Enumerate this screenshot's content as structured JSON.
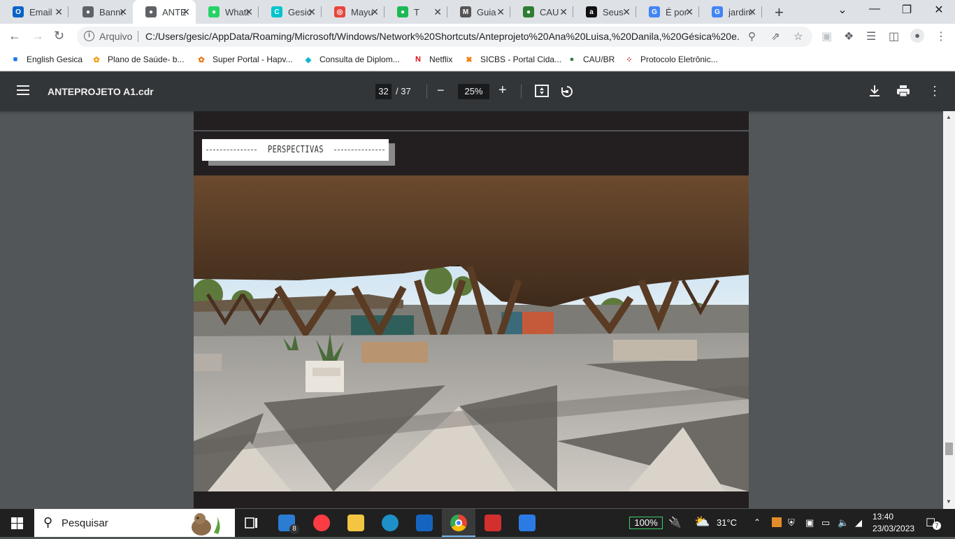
{
  "browser": {
    "tabs": [
      {
        "title": "Email",
        "icon": "outlook-icon",
        "color": "#0a64c8",
        "glyph": "O"
      },
      {
        "title": "Banner",
        "icon": "globe-icon",
        "color": "#5f6368",
        "glyph": "●"
      },
      {
        "title": "ANTEPROJETO",
        "icon": "globe-icon",
        "color": "#5f6368",
        "glyph": "●"
      },
      {
        "title": "WhatsApp",
        "icon": "whatsapp-icon",
        "color": "#25d366",
        "glyph": "●"
      },
      {
        "title": "Gesica",
        "icon": "canva-icon",
        "color": "#00c4cc",
        "glyph": "C"
      },
      {
        "title": "Mayu",
        "icon": "target-icon",
        "color": "#e8453c",
        "glyph": "◎"
      },
      {
        "title": "T",
        "icon": "spotify-icon",
        "color": "#1db954",
        "glyph": "●"
      },
      {
        "title": "Guia",
        "icon": "medium-icon",
        "color": "#555555",
        "glyph": "M"
      },
      {
        "title": "CAU",
        "icon": "cau-icon",
        "color": "#2e7d32",
        "glyph": "●"
      },
      {
        "title": "Seus",
        "icon": "amazon-icon",
        "color": "#111111",
        "glyph": "a"
      },
      {
        "title": "É por",
        "icon": "google-icon",
        "color": "#4285f4",
        "glyph": "G"
      },
      {
        "title": "jardim",
        "icon": "google-icon",
        "color": "#4285f4",
        "glyph": "G"
      }
    ],
    "new_tab": "+",
    "window_controls": {
      "list": "⌄",
      "minimize": "—",
      "restore": "❐",
      "close": "✕"
    },
    "address": {
      "scheme_label": "Arquivo",
      "url": "C:/Users/gesic/AppData/Roaming/Microsoft/Windows/Network%20Shortcuts/Anteprojeto%20Ana%20Luisa,%20Danila,%20Gésica%20e..."
    },
    "bookmarks": [
      {
        "label": "English Gesica",
        "icon": "contact-icon",
        "color": "#1a73e8",
        "glyph": "■"
      },
      {
        "label": "Plano de Saúde- b...",
        "icon": "flower-icon",
        "color": "#f29900",
        "glyph": "✿"
      },
      {
        "label": "Super Portal - Hapv...",
        "icon": "flower-icon",
        "color": "#e8710a",
        "glyph": "✿"
      },
      {
        "label": "Consulta de Diplom...",
        "icon": "diamond-icon",
        "color": "#12b5cb",
        "glyph": "◆"
      },
      {
        "label": "Netflix",
        "icon": "netflix-icon",
        "color": "#e50914",
        "glyph": "N"
      },
      {
        "label": "SICBS - Portal Cida...",
        "icon": "sicbs-icon",
        "color": "#f57c00",
        "glyph": "✖"
      },
      {
        "label": "CAU/BR",
        "icon": "cau-icon",
        "color": "#2e7d32",
        "glyph": "●"
      },
      {
        "label": "Protocolo Eletrônic...",
        "icon": "dots-icon",
        "color": "#c5221f",
        "glyph": "⁘"
      }
    ]
  },
  "pdf": {
    "title": "ANTEPROJETO A1.cdr",
    "current_page": "32",
    "total_pages": "/ 37",
    "zoom": "25%",
    "zoom_out": "−",
    "zoom_in": "+",
    "section_title": "PERSPECTIVAS",
    "scroll_position": 0.85
  },
  "taskbar": {
    "search_placeholder": "Pesquisar",
    "mail_badge": "8",
    "battery": "100%",
    "weather": "31°C",
    "time": "13:40",
    "date": "23/03/2023",
    "notifications": "7"
  }
}
